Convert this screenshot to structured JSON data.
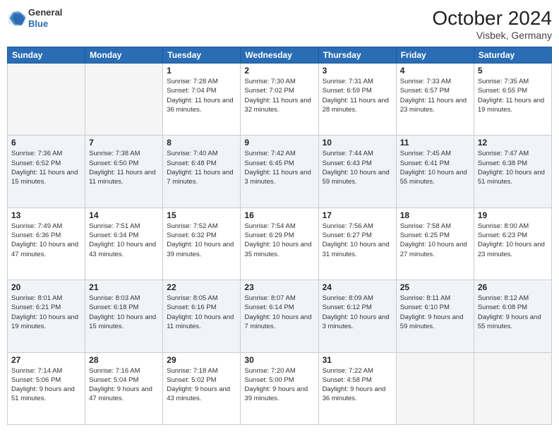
{
  "header": {
    "logo_general": "General",
    "logo_blue": "Blue",
    "month_year": "October 2024",
    "location": "Visbek, Germany"
  },
  "days_of_week": [
    "Sunday",
    "Monday",
    "Tuesday",
    "Wednesday",
    "Thursday",
    "Friday",
    "Saturday"
  ],
  "weeks": [
    [
      {
        "day": "",
        "sunrise": "",
        "sunset": "",
        "daylight": ""
      },
      {
        "day": "",
        "sunrise": "",
        "sunset": "",
        "daylight": ""
      },
      {
        "day": "1",
        "sunrise": "Sunrise: 7:28 AM",
        "sunset": "Sunset: 7:04 PM",
        "daylight": "Daylight: 11 hours and 36 minutes."
      },
      {
        "day": "2",
        "sunrise": "Sunrise: 7:30 AM",
        "sunset": "Sunset: 7:02 PM",
        "daylight": "Daylight: 11 hours and 32 minutes."
      },
      {
        "day": "3",
        "sunrise": "Sunrise: 7:31 AM",
        "sunset": "Sunset: 6:59 PM",
        "daylight": "Daylight: 11 hours and 28 minutes."
      },
      {
        "day": "4",
        "sunrise": "Sunrise: 7:33 AM",
        "sunset": "Sunset: 6:57 PM",
        "daylight": "Daylight: 11 hours and 23 minutes."
      },
      {
        "day": "5",
        "sunrise": "Sunrise: 7:35 AM",
        "sunset": "Sunset: 6:55 PM",
        "daylight": "Daylight: 11 hours and 19 minutes."
      }
    ],
    [
      {
        "day": "6",
        "sunrise": "Sunrise: 7:36 AM",
        "sunset": "Sunset: 6:52 PM",
        "daylight": "Daylight: 11 hours and 15 minutes."
      },
      {
        "day": "7",
        "sunrise": "Sunrise: 7:38 AM",
        "sunset": "Sunset: 6:50 PM",
        "daylight": "Daylight: 11 hours and 11 minutes."
      },
      {
        "day": "8",
        "sunrise": "Sunrise: 7:40 AM",
        "sunset": "Sunset: 6:48 PM",
        "daylight": "Daylight: 11 hours and 7 minutes."
      },
      {
        "day": "9",
        "sunrise": "Sunrise: 7:42 AM",
        "sunset": "Sunset: 6:45 PM",
        "daylight": "Daylight: 11 hours and 3 minutes."
      },
      {
        "day": "10",
        "sunrise": "Sunrise: 7:44 AM",
        "sunset": "Sunset: 6:43 PM",
        "daylight": "Daylight: 10 hours and 59 minutes."
      },
      {
        "day": "11",
        "sunrise": "Sunrise: 7:45 AM",
        "sunset": "Sunset: 6:41 PM",
        "daylight": "Daylight: 10 hours and 55 minutes."
      },
      {
        "day": "12",
        "sunrise": "Sunrise: 7:47 AM",
        "sunset": "Sunset: 6:38 PM",
        "daylight": "Daylight: 10 hours and 51 minutes."
      }
    ],
    [
      {
        "day": "13",
        "sunrise": "Sunrise: 7:49 AM",
        "sunset": "Sunset: 6:36 PM",
        "daylight": "Daylight: 10 hours and 47 minutes."
      },
      {
        "day": "14",
        "sunrise": "Sunrise: 7:51 AM",
        "sunset": "Sunset: 6:34 PM",
        "daylight": "Daylight: 10 hours and 43 minutes."
      },
      {
        "day": "15",
        "sunrise": "Sunrise: 7:52 AM",
        "sunset": "Sunset: 6:32 PM",
        "daylight": "Daylight: 10 hours and 39 minutes."
      },
      {
        "day": "16",
        "sunrise": "Sunrise: 7:54 AM",
        "sunset": "Sunset: 6:29 PM",
        "daylight": "Daylight: 10 hours and 35 minutes."
      },
      {
        "day": "17",
        "sunrise": "Sunrise: 7:56 AM",
        "sunset": "Sunset: 6:27 PM",
        "daylight": "Daylight: 10 hours and 31 minutes."
      },
      {
        "day": "18",
        "sunrise": "Sunrise: 7:58 AM",
        "sunset": "Sunset: 6:25 PM",
        "daylight": "Daylight: 10 hours and 27 minutes."
      },
      {
        "day": "19",
        "sunrise": "Sunrise: 8:00 AM",
        "sunset": "Sunset: 6:23 PM",
        "daylight": "Daylight: 10 hours and 23 minutes."
      }
    ],
    [
      {
        "day": "20",
        "sunrise": "Sunrise: 8:01 AM",
        "sunset": "Sunset: 6:21 PM",
        "daylight": "Daylight: 10 hours and 19 minutes."
      },
      {
        "day": "21",
        "sunrise": "Sunrise: 8:03 AM",
        "sunset": "Sunset: 6:18 PM",
        "daylight": "Daylight: 10 hours and 15 minutes."
      },
      {
        "day": "22",
        "sunrise": "Sunrise: 8:05 AM",
        "sunset": "Sunset: 6:16 PM",
        "daylight": "Daylight: 10 hours and 11 minutes."
      },
      {
        "day": "23",
        "sunrise": "Sunrise: 8:07 AM",
        "sunset": "Sunset: 6:14 PM",
        "daylight": "Daylight: 10 hours and 7 minutes."
      },
      {
        "day": "24",
        "sunrise": "Sunrise: 8:09 AM",
        "sunset": "Sunset: 6:12 PM",
        "daylight": "Daylight: 10 hours and 3 minutes."
      },
      {
        "day": "25",
        "sunrise": "Sunrise: 8:11 AM",
        "sunset": "Sunset: 6:10 PM",
        "daylight": "Daylight: 9 hours and 59 minutes."
      },
      {
        "day": "26",
        "sunrise": "Sunrise: 8:12 AM",
        "sunset": "Sunset: 6:08 PM",
        "daylight": "Daylight: 9 hours and 55 minutes."
      }
    ],
    [
      {
        "day": "27",
        "sunrise": "Sunrise: 7:14 AM",
        "sunset": "Sunset: 5:06 PM",
        "daylight": "Daylight: 9 hours and 51 minutes."
      },
      {
        "day": "28",
        "sunrise": "Sunrise: 7:16 AM",
        "sunset": "Sunset: 5:04 PM",
        "daylight": "Daylight: 9 hours and 47 minutes."
      },
      {
        "day": "29",
        "sunrise": "Sunrise: 7:18 AM",
        "sunset": "Sunset: 5:02 PM",
        "daylight": "Daylight: 9 hours and 43 minutes."
      },
      {
        "day": "30",
        "sunrise": "Sunrise: 7:20 AM",
        "sunset": "Sunset: 5:00 PM",
        "daylight": "Daylight: 9 hours and 39 minutes."
      },
      {
        "day": "31",
        "sunrise": "Sunrise: 7:22 AM",
        "sunset": "Sunset: 4:58 PM",
        "daylight": "Daylight: 9 hours and 36 minutes."
      },
      {
        "day": "",
        "sunrise": "",
        "sunset": "",
        "daylight": ""
      },
      {
        "day": "",
        "sunrise": "",
        "sunset": "",
        "daylight": ""
      }
    ]
  ]
}
